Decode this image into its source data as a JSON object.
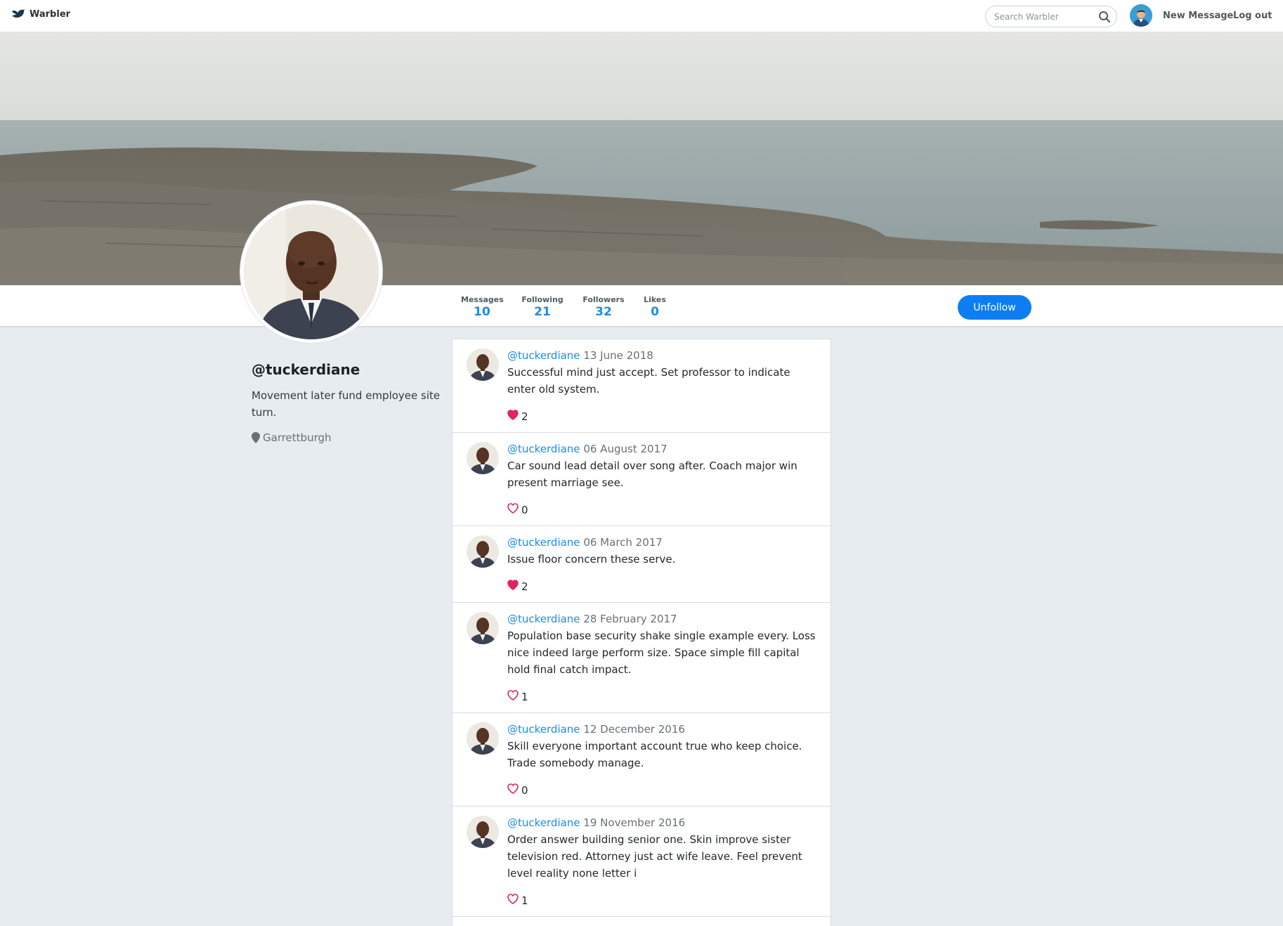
{
  "navbar": {
    "brand": "Warbler",
    "search_placeholder": "Search Warbler",
    "new_message": "New Message",
    "logout": "Log out"
  },
  "profile": {
    "handle": "@tuckerdiane",
    "bio": "Movement later fund employee site turn.",
    "location": "Garrettburgh"
  },
  "stats": {
    "messages_label": "Messages",
    "messages": "10",
    "following_label": "Following",
    "following": "21",
    "followers_label": "Followers",
    "followers": "32",
    "likes_label": "Likes",
    "likes": "0"
  },
  "actions": {
    "unfollow": "Unfollow"
  },
  "messages": [
    {
      "user": "@tuckerdiane",
      "date": "13 June 2018",
      "text": "Successful mind just accept. Set professor to indicate enter old system.",
      "likes": "2",
      "liked": true
    },
    {
      "user": "@tuckerdiane",
      "date": "06 August 2017",
      "text": "Car sound lead detail over song after. Coach major win present marriage see.",
      "likes": "0",
      "liked": false
    },
    {
      "user": "@tuckerdiane",
      "date": "06 March 2017",
      "text": "Issue floor concern these serve.",
      "likes": "2",
      "liked": true
    },
    {
      "user": "@tuckerdiane",
      "date": "28 February 2017",
      "text": "Population base security shake single example every. Loss nice indeed large perform size. Space simple fill capital hold final catch impact.",
      "likes": "1",
      "liked": false
    },
    {
      "user": "@tuckerdiane",
      "date": "12 December 2016",
      "text": "Skill everyone important account true who keep choice. Trade somebody manage.",
      "likes": "0",
      "liked": false
    },
    {
      "user": "@tuckerdiane",
      "date": "19 November 2016",
      "text": "Order answer building senior one. Skin improve sister television red. Attorney just act wife leave. Feel prevent level reality none letter i",
      "likes": "1",
      "liked": false
    }
  ],
  "colors": {
    "accent": "#1d8ce8",
    "button": "#0d7ef2",
    "like_red": "#e0245e",
    "background": "#e6ecf0"
  }
}
